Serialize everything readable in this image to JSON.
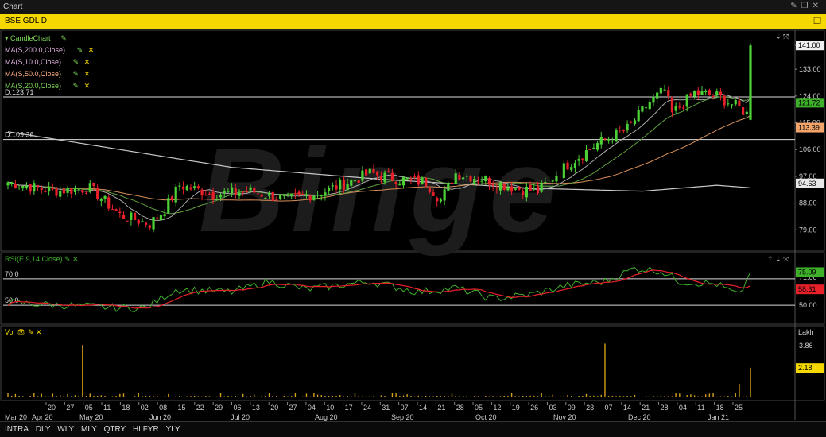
{
  "window": {
    "title": "Chart"
  },
  "symbol_bar": {
    "title": "BSE GDL D"
  },
  "price_panel": {
    "legend": [
      {
        "label": "CandleChart",
        "color": "#7ed957",
        "has_close": false
      },
      {
        "label": "MA(S,200.0,Close)",
        "color": "#e0b0e0",
        "has_close": true
      },
      {
        "label": "MA(S,10.0,Close)",
        "color": "#e0b0e0",
        "has_close": true
      },
      {
        "label": "MA(S,50.0,Close)",
        "color": "#ffb080",
        "has_close": true
      },
      {
        "label": "MA(S,20.0,Close)",
        "color": "#7ed957",
        "has_close": true
      }
    ],
    "hline_upper_label": "D:123.71",
    "hline_lower_label": "D:109.36",
    "y_ticks": [
      "141.00",
      "133.00",
      "124.00",
      "115.00",
      "106.00",
      "97.00",
      "88.00",
      "79.00"
    ],
    "tags": {
      "last_price": "121.72",
      "ma50": "113.39",
      "ma200": "94.63"
    },
    "colors": {
      "up": "#4cd137",
      "down": "#e8202a",
      "ma200": "#c8c8c8",
      "ma10": "#aaaaaa",
      "ma50": "#d9905a",
      "ma20": "#5fa040"
    }
  },
  "rsi_panel": {
    "label": "RSI(E,9,14,Close)",
    "level_high_label": "70.0",
    "level_low_label": "50.0",
    "y_ticks": [
      "71.00",
      "50.00"
    ],
    "tags": {
      "rsi": "75.09",
      "signal": "58.31"
    }
  },
  "volume_panel": {
    "label": "Vol",
    "unit": "Lakh",
    "y_ticks": [
      "3.86"
    ],
    "tag": "2.18"
  },
  "x_axis": {
    "days": [
      "20",
      "27",
      "05",
      "11",
      "18",
      "02",
      "08",
      "15",
      "22",
      "29",
      "06",
      "13",
      "20",
      "27",
      "04",
      "10",
      "17",
      "24",
      "31",
      "07",
      "14",
      "21",
      "28",
      "05",
      "12",
      "19",
      "26",
      "03",
      "09",
      "23",
      "07",
      "14",
      "21",
      "28",
      "04",
      "11",
      "18",
      "25"
    ],
    "months": [
      "Mar 20",
      "Apr 20",
      "May 20",
      "Jun 20",
      "Jul 20",
      "Aug 20",
      "Sep 20",
      "Oct 20",
      "Nov 20",
      "Dec 20",
      "Jan 21"
    ]
  },
  "timeframes": [
    "INTRA",
    "DLY",
    "WLY",
    "MLY",
    "QTRY",
    "HLFYR",
    "YLY"
  ],
  "chart_data": {
    "type": "candlestick",
    "title": "BSE GDL D",
    "y_range": [
      74,
      144
    ],
    "points": 200,
    "close_anchors": [
      [
        0,
        95
      ],
      [
        12,
        92
      ],
      [
        22,
        93
      ],
      [
        30,
        84
      ],
      [
        38,
        81
      ],
      [
        42,
        86
      ],
      [
        46,
        94
      ],
      [
        55,
        91
      ],
      [
        65,
        92
      ],
      [
        75,
        89
      ],
      [
        85,
        92
      ],
      [
        97,
        98
      ],
      [
        105,
        96
      ],
      [
        112,
        95
      ],
      [
        116,
        89
      ],
      [
        120,
        98
      ],
      [
        128,
        96
      ],
      [
        136,
        93
      ],
      [
        142,
        92
      ],
      [
        150,
        101
      ],
      [
        158,
        108
      ],
      [
        166,
        113
      ],
      [
        172,
        122
      ],
      [
        176,
        126
      ],
      [
        178,
        118
      ],
      [
        184,
        125
      ],
      [
        190,
        124
      ],
      [
        196,
        120
      ],
      [
        198,
        118
      ],
      [
        199,
        141
      ]
    ],
    "ma200_anchors": [
      [
        0,
        112
      ],
      [
        30,
        106
      ],
      [
        60,
        100
      ],
      [
        100,
        96
      ],
      [
        140,
        93
      ],
      [
        170,
        92
      ],
      [
        190,
        94
      ]
    ],
    "rsi_anchors": [
      [
        0,
        52
      ],
      [
        30,
        48
      ],
      [
        37,
        48
      ],
      [
        45,
        62
      ],
      [
        60,
        60
      ],
      [
        70,
        68
      ],
      [
        80,
        62
      ],
      [
        97,
        68
      ],
      [
        110,
        60
      ],
      [
        120,
        63
      ],
      [
        130,
        55
      ],
      [
        140,
        58
      ],
      [
        150,
        65
      ],
      [
        160,
        68
      ],
      [
        168,
        78
      ],
      [
        175,
        76
      ],
      [
        180,
        68
      ],
      [
        190,
        66
      ],
      [
        196,
        57
      ],
      [
        199,
        75
      ]
    ],
    "volume_spikes": [
      [
        20,
        3.9
      ],
      [
        160,
        4.0
      ],
      [
        196,
        1.0
      ],
      [
        199,
        2.2
      ]
    ]
  }
}
